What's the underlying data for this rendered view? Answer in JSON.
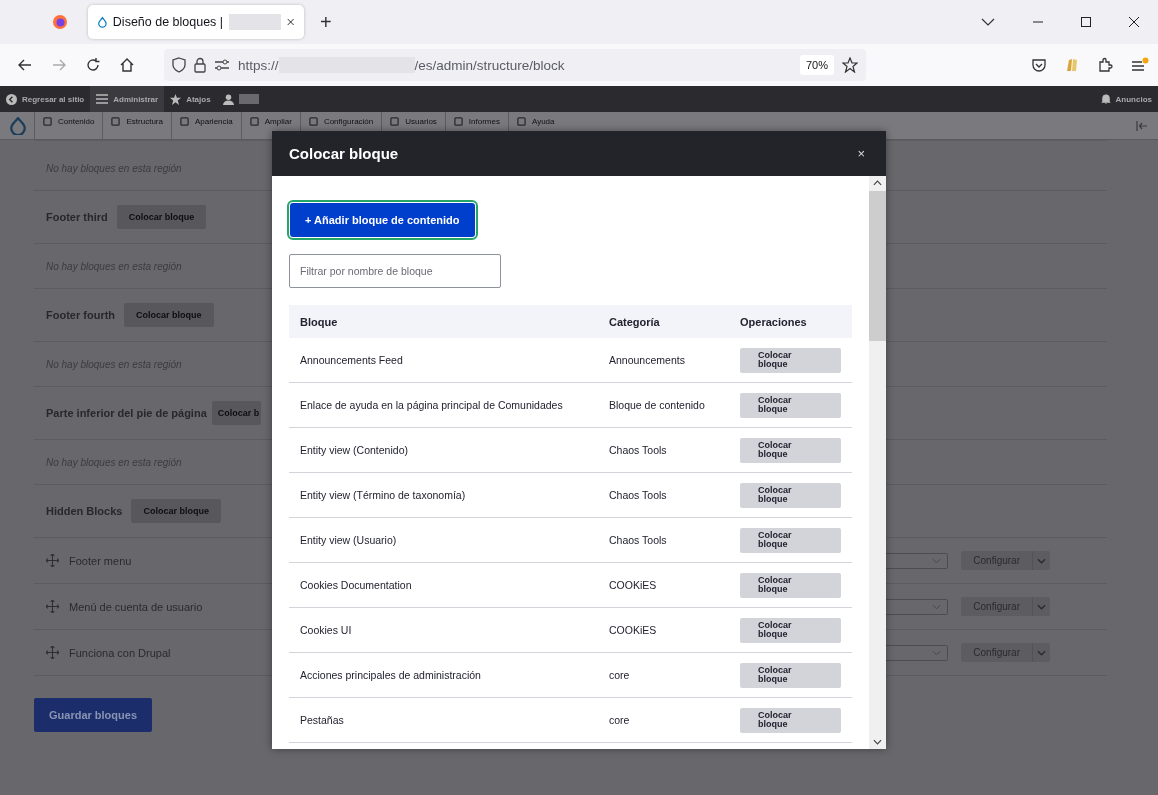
{
  "browser": {
    "tab_title": "Diseño de bloques |",
    "new_tab": "+",
    "url_scheme": "https://",
    "url_path": "/es/admin/structure/block",
    "zoom": "70%"
  },
  "toolbar": {
    "back": "Regresar al sitio",
    "manage": "Administrar",
    "shortcuts": "Atajos",
    "announcements": "Anuncios"
  },
  "admin_menu": [
    "Contenido",
    "Estructura",
    "Apariencia",
    "Ampliar",
    "Configuración",
    "Usuarios",
    "Informes",
    "Ayuda"
  ],
  "page": {
    "items": [
      {
        "kind": "empty",
        "text": "No hay bloques en esta región"
      },
      {
        "kind": "region",
        "title": "Footer third",
        "button": "Colocar bloque"
      },
      {
        "kind": "empty",
        "text": "No hay bloques en esta región"
      },
      {
        "kind": "region",
        "title": "Footer fourth",
        "button": "Colocar bloque"
      },
      {
        "kind": "empty",
        "text": "No hay bloques en esta región"
      },
      {
        "kind": "region",
        "title": "Parte inferior del pie de página",
        "button": "Colocar b"
      },
      {
        "kind": "empty",
        "text": "No hay bloques en esta región"
      },
      {
        "kind": "region",
        "title": "Hidden Blocks",
        "button": "Colocar bloque"
      },
      {
        "kind": "block",
        "title": "Footer menu",
        "button": "Configurar"
      },
      {
        "kind": "block",
        "title": "Menú de cuenta de usuario",
        "button": "Configurar"
      },
      {
        "kind": "block",
        "title": "Funciona con Drupal",
        "button": "Configurar"
      }
    ],
    "save_button": "Guardar bloques"
  },
  "modal": {
    "title": "Colocar bloque",
    "close": "×",
    "add_button": "+ Añadir bloque de contenido",
    "filter_placeholder": "Filtrar por nombre de bloque",
    "columns": [
      "Bloque",
      "Categoría",
      "Operaciones"
    ],
    "rows": [
      {
        "block": "Announcements Feed",
        "category": "Announcements",
        "action": "Colocar bloque"
      },
      {
        "block": "Enlace de ayuda en la página principal de Comunidades",
        "category": "Bloque de contenido",
        "action": "Colocar bloque"
      },
      {
        "block": "Entity view (Contenido)",
        "category": "Chaos Tools",
        "action": "Colocar bloque"
      },
      {
        "block": "Entity view (Término de taxonomía)",
        "category": "Chaos Tools",
        "action": "Colocar bloque"
      },
      {
        "block": "Entity view (Usuario)",
        "category": "Chaos Tools",
        "action": "Colocar bloque"
      },
      {
        "block": "Cookies Documentation",
        "category": "COOKiES",
        "action": "Colocar bloque"
      },
      {
        "block": "Cookies UI",
        "category": "COOKiES",
        "action": "Colocar bloque"
      },
      {
        "block": "Acciones principales de administración",
        "category": "core",
        "action": "Colocar bloque"
      },
      {
        "block": "Pestañas",
        "category": "core",
        "action": "Colocar bloque"
      }
    ]
  }
}
